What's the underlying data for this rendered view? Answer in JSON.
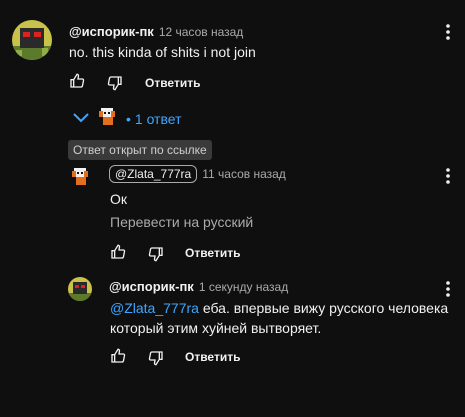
{
  "comments": [
    {
      "author": "@испорик-пк",
      "time": "12 часов назад",
      "text": "no. this kinda of shits i not join",
      "reply_label": "Ответить"
    },
    {
      "author": "@Zlata_777ra",
      "time": "11 часов назад",
      "text": "Ок",
      "translate_label": "Перевести на русский",
      "reply_label": "Ответить"
    },
    {
      "author": "@испорик-пк",
      "time": "1 секунду назад",
      "mention": "@Zlata_777ra",
      "text_line1": " еба. впервые вижу русского человека",
      "text_line2": "который этим хуйней вытворяет.",
      "reply_label": "Ответить"
    }
  ],
  "replies_toggle": {
    "count_label": "1 ответ",
    "separator": "•"
  },
  "linked_badge": "Ответ открыт по ссылке",
  "colors": {
    "background": "#0f0f0f",
    "link": "#3ea6ff",
    "muted": "#aaaaaa"
  },
  "icons": [
    "like-icon",
    "dislike-icon",
    "more-vert-icon",
    "chevron-down-icon"
  ]
}
